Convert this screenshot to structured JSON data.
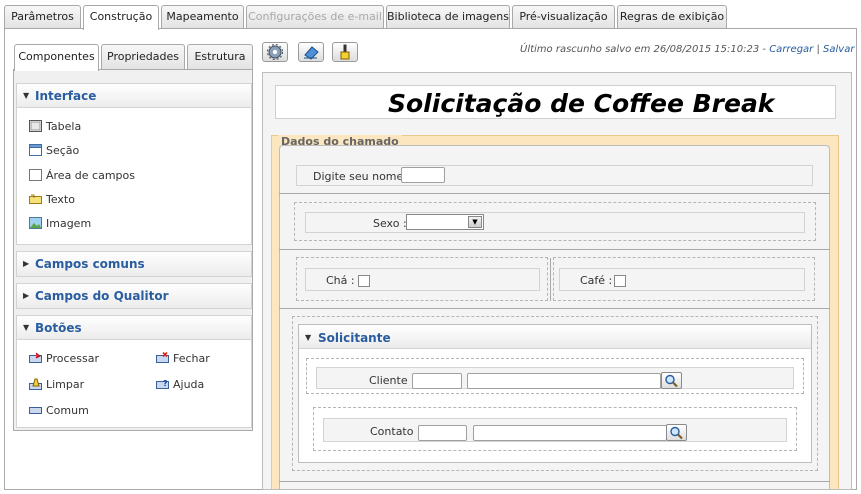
{
  "top_tabs": [
    {
      "label": "Parâmetros",
      "active": false,
      "disabled": false
    },
    {
      "label": "Construção",
      "active": true,
      "disabled": false
    },
    {
      "label": "Mapeamento",
      "active": false,
      "disabled": false
    },
    {
      "label": "Configurações de e-mail",
      "active": false,
      "disabled": true
    },
    {
      "label": "Biblioteca de imagens",
      "active": false,
      "disabled": false
    },
    {
      "label": "Pré-visualização",
      "active": false,
      "disabled": false
    },
    {
      "label": "Regras de exibição",
      "active": false,
      "disabled": false
    }
  ],
  "left_tabs": [
    {
      "label": "Componentes",
      "active": true
    },
    {
      "label": "Propriedades",
      "active": false
    },
    {
      "label": "Estrutura",
      "active": false
    }
  ],
  "sections": {
    "interface": {
      "title": "Interface",
      "items": [
        "Tabela",
        "Seção",
        "Área de campos",
        "Texto",
        "Imagem"
      ]
    },
    "campos_comuns": {
      "title": "Campos comuns"
    },
    "campos_qualitor": {
      "title": "Campos do Qualitor"
    },
    "botoes": {
      "title": "Botões",
      "items": [
        "Processar",
        "Fechar",
        "Limpar",
        "Ajuda",
        "Comum"
      ]
    }
  },
  "toolbar": {
    "icons": [
      "settings-icon",
      "eraser-icon",
      "brush-icon"
    ]
  },
  "draft": {
    "text": "Último rascunho salvo em 26/08/2015 15:10:23 -",
    "load": "Carregar",
    "sep": "|",
    "save": "Salvar"
  },
  "form": {
    "title": "Solicitação de Coffee Break",
    "fieldset_legend": "Dados do chamado",
    "name_label": "Digite seu nome :",
    "name_value": "",
    "sex_label": "Sexo :",
    "sex_value": "",
    "tea_label": "Chá :",
    "coffee_label": "Café :",
    "subsection_title": "Solicitante",
    "client_label": "Cliente :",
    "contact_label": "Contato :"
  },
  "colors": {
    "accent": "#2a5d9f",
    "fieldset_bg": "#fbe6bf"
  }
}
